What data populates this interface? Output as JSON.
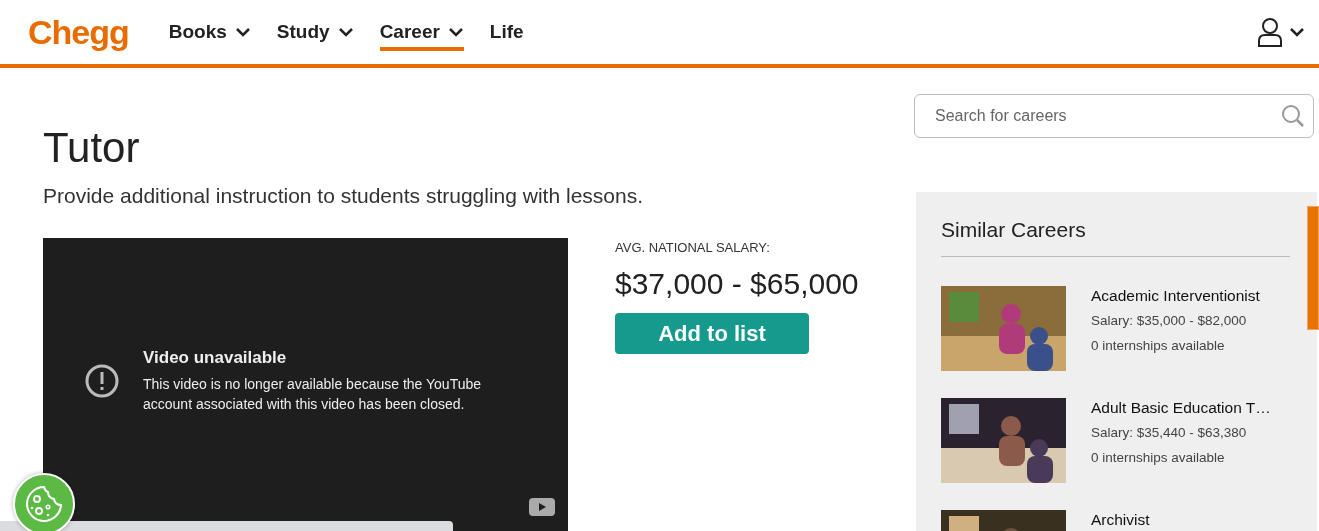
{
  "header": {
    "logo": "Chegg",
    "nav": [
      {
        "label": "Books",
        "dropdown": true,
        "selected": false
      },
      {
        "label": "Study",
        "dropdown": true,
        "selected": false
      },
      {
        "label": "Career",
        "dropdown": true,
        "selected": true
      },
      {
        "label": "Life",
        "dropdown": false,
        "selected": false
      }
    ]
  },
  "career": {
    "title": "Tutor",
    "description": "Provide additional instruction to students struggling with lessons."
  },
  "video": {
    "title": "Video unavailable",
    "message": "This video is no longer available because the YouTube account associated with this video has been closed."
  },
  "salary": {
    "label": "AVG. NATIONAL SALARY:",
    "range": "$37,000 - $65,000",
    "button": "Add to list"
  },
  "search": {
    "placeholder": "Search for careers"
  },
  "similar": {
    "heading": "Similar Careers",
    "items": [
      {
        "title": "Academic Interventionist",
        "salary": "Salary: $35,000 - $82,000",
        "internships": "0 internships available"
      },
      {
        "title": "Adult Basic Education T…",
        "salary": "Salary: $35,440 - $63,380",
        "internships": "0 internships available"
      },
      {
        "title": "Archivist"
      }
    ]
  }
}
